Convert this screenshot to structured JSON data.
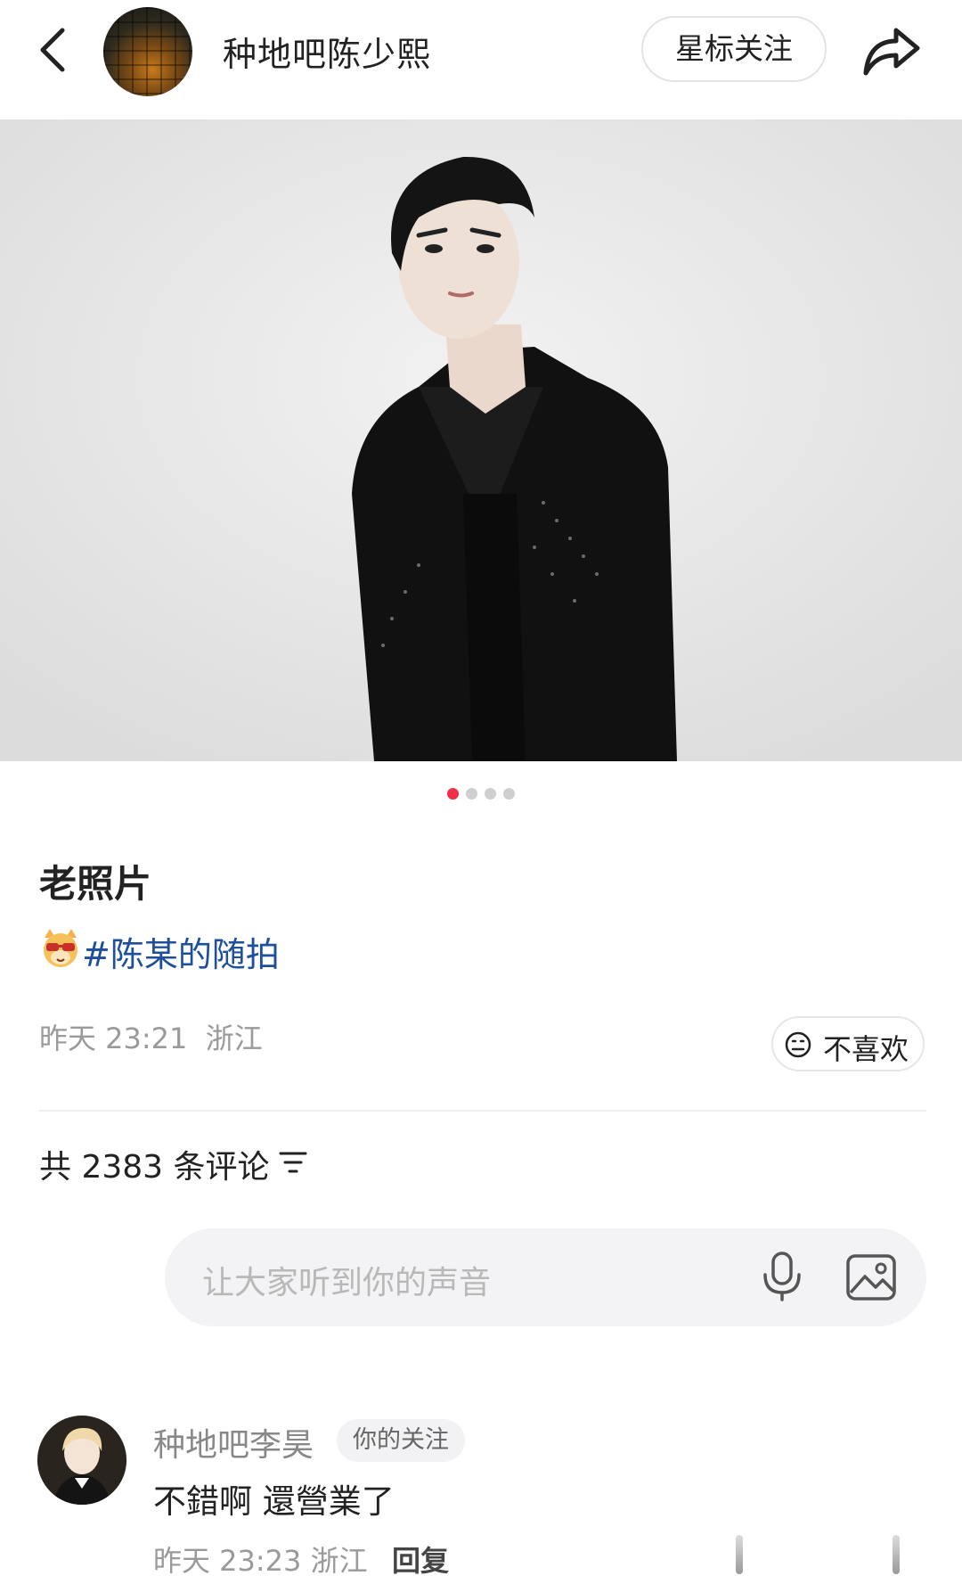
{
  "header": {
    "account_name": "种地吧陈少熙",
    "star_follow_label": "星标关注",
    "icons": [
      "back-icon",
      "avatar",
      "share-icon"
    ]
  },
  "post": {
    "carousel": {
      "total": 4,
      "active_index": 1
    },
    "title": "老照片",
    "topic": "#陈某的随拍",
    "topic_emoji": "cat-sunglasses-emoji",
    "timestamp": "昨天 23:21",
    "location": "浙江",
    "dislike_label": "不喜欢"
  },
  "comments": {
    "count_prefix": "共",
    "count": "2383",
    "count_suffix": "条评论",
    "input_placeholder": "让大家听到你的声音",
    "items": [
      {
        "username": "种地吧李昊",
        "badge": "你的关注",
        "text": "不錯啊 還營業了",
        "timestamp": "昨天 23:23",
        "location": "浙江",
        "reply_label": "回复"
      }
    ]
  },
  "colors": {
    "accent": "#f0304a",
    "topic_link": "#1d4f9b",
    "meta_text": "#9a9a9a"
  }
}
